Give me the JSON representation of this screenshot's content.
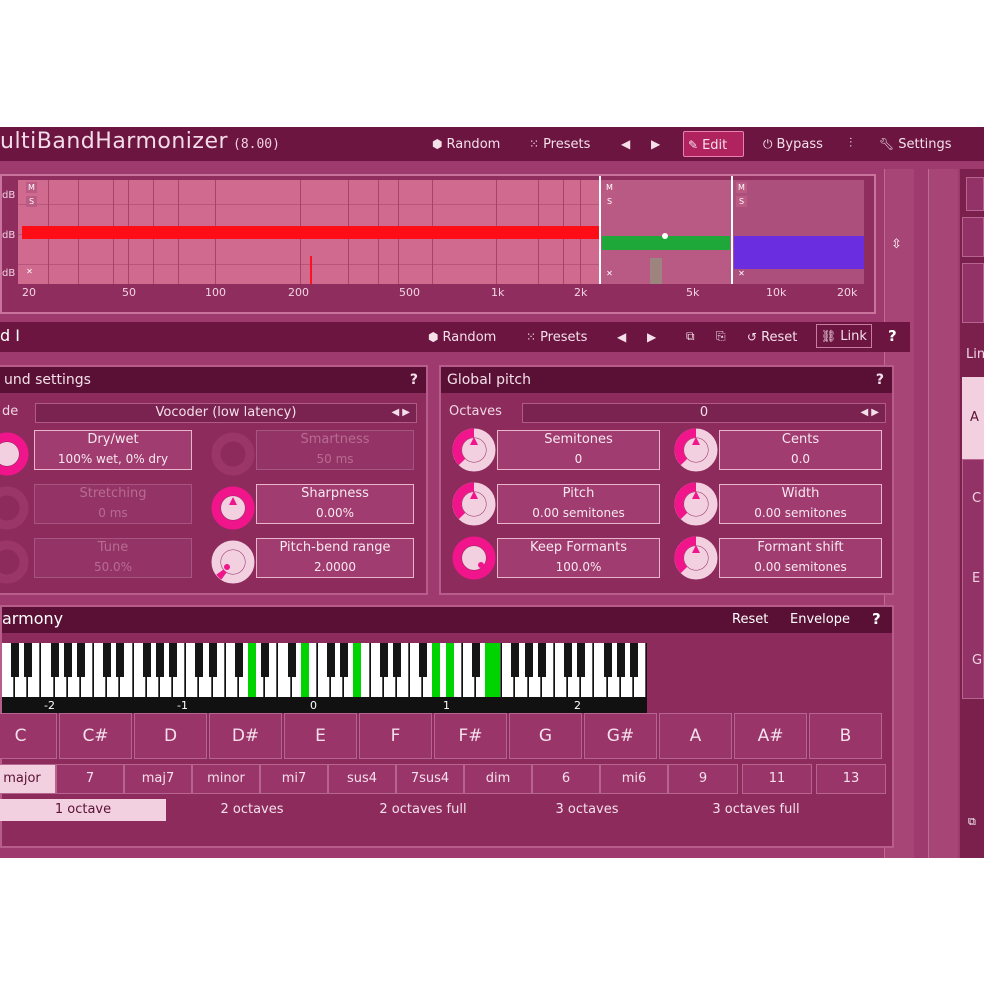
{
  "app": {
    "title": "ultiBandHarmonizer",
    "version": "(8.00)"
  },
  "toolbar": {
    "random": "Random",
    "presets": "Presets",
    "edit": "Edit",
    "bypass": "Bypass",
    "settings": "Settings"
  },
  "analyzer": {
    "db_labels": [
      "dB",
      "dB",
      "dB"
    ],
    "x_labels": [
      "20",
      "50",
      "100",
      "200",
      "500",
      "1k",
      "2k",
      "5k",
      "10k",
      "20k"
    ],
    "bands": [
      {
        "color": "#ff0d17"
      },
      {
        "color": "#1ea839"
      },
      {
        "color": "#6a2ee0"
      }
    ],
    "mute_letter": "M",
    "solo_letter": "S",
    "close_letter": "✕"
  },
  "band_toolbar": {
    "title": "d I",
    "random": "Random",
    "presets": "Presets",
    "reset": "Reset",
    "link": "Link",
    "help": "?"
  },
  "band_settings": {
    "title": "und settings",
    "help": "?",
    "mode_label": "de",
    "mode_value": "Vocoder (low latency)",
    "dry_wet": {
      "name": "Dry/wet",
      "value": "100% wet, 0% dry"
    },
    "smartness": {
      "name": "Smartness",
      "value": "50 ms"
    },
    "stretching": {
      "name": "Stretching",
      "value": "0 ms"
    },
    "tune": {
      "name": "Tune",
      "value": "50.0%"
    },
    "sharpness": {
      "name": "Sharpness",
      "value": "0.00%",
      "level": 0.35
    },
    "pitch_bend": {
      "name": "Pitch-bend range",
      "value": "2.0000",
      "level": 0.1
    }
  },
  "global_pitch": {
    "title": "Global pitch",
    "help": "?",
    "octaves_label": "Octaves",
    "octaves_value": "0",
    "semitones": {
      "name": "Semitones",
      "value": "0",
      "level": 0.5
    },
    "cents": {
      "name": "Cents",
      "value": "0.0",
      "level": 0.5
    },
    "pitch": {
      "name": "Pitch",
      "value": "0.00 semitones",
      "level": 0.5
    },
    "width": {
      "name": "Width",
      "value": "0.00 semitones",
      "level": 0.5
    },
    "keep_formants": {
      "name": "Keep Formants",
      "value": "100.0%",
      "level": 1.0
    },
    "formant_shift": {
      "name": "Formant shift",
      "value": "0.00 semitones",
      "level": 0.5
    }
  },
  "harmony": {
    "title": "armony",
    "reset": "Reset",
    "envelope": "Envelope",
    "help": "?",
    "octave_labels": [
      "-2",
      "-1",
      "0",
      "1",
      "2"
    ],
    "notes": [
      "C",
      "C#",
      "D",
      "D#",
      "E",
      "F",
      "F#",
      "G",
      "G#",
      "A",
      "A#",
      "B"
    ],
    "chords": [
      "major",
      "7",
      "maj7",
      "minor",
      "mi7",
      "sus4",
      "7sus4",
      "dim",
      "6",
      "mi6"
    ],
    "extensions": [
      "9",
      "11",
      "13"
    ],
    "octave_modes": [
      "1 octave",
      "2 octaves",
      "2 octaves full",
      "3 octaves",
      "3 octaves full"
    ]
  },
  "right_panel": {
    "labels": [
      "Lin",
      "A",
      "C",
      "E",
      "G"
    ]
  },
  "colors": {
    "accent": "#f0158a",
    "background": "#9e3a6e",
    "titlebar": "#6b1540"
  }
}
